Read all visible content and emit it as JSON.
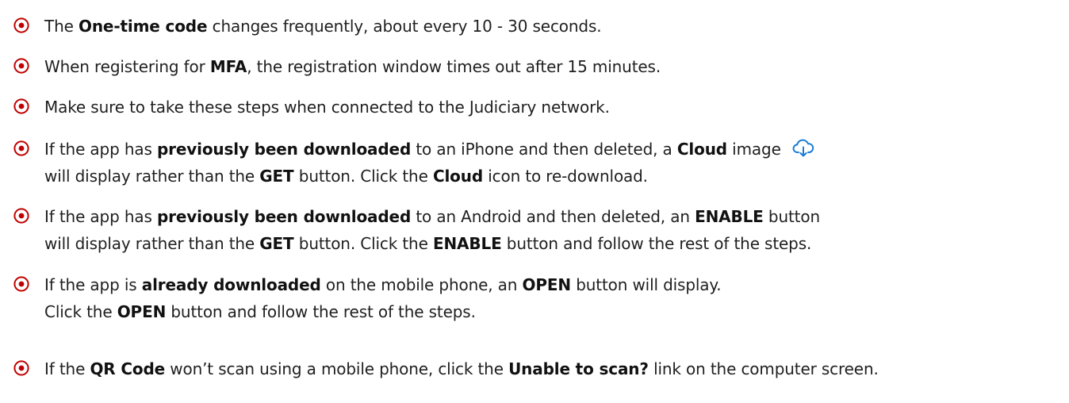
{
  "accent_color": "#c00000",
  "cloud_icon_color": "#1a7cd4",
  "items": [
    {
      "bullet_icon": "circled-dot-icon",
      "line1": {
        "a": "The ",
        "b1": "One-time code",
        "c": " changes frequently, about every 10 - 30 seconds."
      }
    },
    {
      "bullet_icon": "circled-dot-icon",
      "line1": {
        "a": "When registering for ",
        "b1": "MFA",
        "c": ", the registration window times out after 15 minutes."
      }
    },
    {
      "bullet_icon": "circled-dot-icon",
      "line1": {
        "a": "Make sure to take these steps when connected to the Judiciary network."
      }
    },
    {
      "bullet_icon": "circled-dot-icon",
      "line1": {
        "a": "If the app has ",
        "b1": "previously been downloaded",
        "c": " to an iPhone and then deleted, a ",
        "b2": "Cloud",
        "d": " image",
        "icon": "cloud-download-icon"
      },
      "line2": {
        "a": "will display rather than the ",
        "b1": "GET",
        "c": " button. Click the ",
        "b2": "Cloud",
        "d": " icon to re-download."
      }
    },
    {
      "bullet_icon": "circled-dot-icon",
      "line1": {
        "a": "If the app has ",
        "b1": "previously been downloaded",
        "c": " to an Android and then deleted, an ",
        "b2": "ENABLE",
        "d": " button"
      },
      "line2": {
        "a": "will display rather than the ",
        "b1": "GET",
        "c": " button. Click the ",
        "b2": "ENABLE",
        "d": " button and follow the rest of the steps."
      }
    },
    {
      "bullet_icon": "circled-dot-icon",
      "line1": {
        "a": "If the app is ",
        "b1": "already downloaded",
        "c": " on the mobile phone, an ",
        "b2": "OPEN",
        "d": " button will display."
      },
      "line2": {
        "a": "Click the ",
        "b1": "OPEN",
        "c": " button and follow the rest of the steps."
      }
    },
    {
      "bullet_icon": "circled-dot-icon",
      "line1": {
        "a": "If the ",
        "b1": "QR Code",
        "c": " won’t scan using a mobile phone, click the ",
        "b2": "Unable to scan?",
        "d": " link on the computer screen."
      }
    }
  ]
}
